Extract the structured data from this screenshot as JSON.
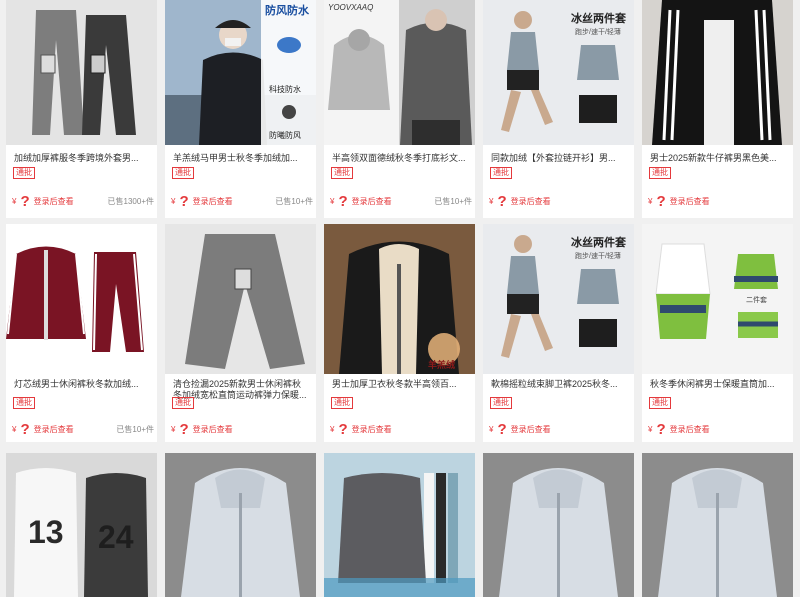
{
  "products": [
    {
      "title": "加绒加厚裤服冬季跨境外套男...",
      "badge": "通批",
      "yen": "¥",
      "price_mark": "?",
      "login_text": "登录后查看",
      "sold": "已售1300+件",
      "image_icon": "grey-sweatpants-image"
    },
    {
      "title": "羊羔绒马甲男士秋冬季加绒加...",
      "badge": "通批",
      "yen": "¥",
      "price_mark": "?",
      "login_text": "登录后查看",
      "sold": "已售10+件",
      "image_icon": "black-jacket-model-image",
      "image_text": [
        "防风防水",
        "科技防水",
        "防曦防风"
      ]
    },
    {
      "title": "半高领双面德绒秋冬季打底衫文...",
      "badge": "通批",
      "yen": "¥",
      "price_mark": "?",
      "login_text": "登录后查看",
      "sold": "已售10+件",
      "image_icon": "grey-hoodie-image",
      "image_text": [
        "YOOVXAAQ"
      ]
    },
    {
      "title": "同款加绒【外套拉链开衫】男...",
      "badge": "通批",
      "yen": "¥",
      "price_mark": "?",
      "login_text": "登录后查看",
      "sold": "",
      "image_icon": "running-set-image",
      "image_text": [
        "冰丝两件套",
        "跑步/速干/轻薄"
      ]
    },
    {
      "title": "男士2025新款牛仔裤男黑色美...",
      "badge": "通批",
      "yen": "¥",
      "price_mark": "?",
      "login_text": "登录后查看",
      "sold": "",
      "image_icon": "black-track-jacket-image"
    },
    {
      "title": "灯芯绒男士休闲裤秋冬款加绒...",
      "badge": "通批",
      "yen": "¥",
      "price_mark": "?",
      "login_text": "登录后查看",
      "sold": "已售10+件",
      "image_icon": "maroon-tracksuit-image"
    },
    {
      "title": "清仓捡漏2025新款男士休闲裤秋冬加绒宽松直筒运动裤弹力保暖...",
      "badge": "通批",
      "yen": "¥",
      "price_mark": "?",
      "login_text": "登录后查看",
      "sold": "",
      "image_icon": "grey-sweatpants-image"
    },
    {
      "title": "男士加厚卫衣秋冬款半高领百...",
      "badge": "通批",
      "yen": "¥",
      "price_mark": "?",
      "login_text": "登录后查看",
      "sold": "",
      "image_icon": "sherpa-hoodie-image",
      "image_text": [
        "羊羔绒"
      ]
    },
    {
      "title": "軟棉摇粒绒束脚卫裤2025秋冬...",
      "badge": "通批",
      "yen": "¥",
      "price_mark": "?",
      "login_text": "登录后查看",
      "sold": "",
      "image_icon": "running-set-image",
      "image_text": [
        "冰丝两件套",
        "跑步/速干/轻薄"
      ]
    },
    {
      "title": "秋冬季休闲裤男士保暖直筒加...",
      "badge": "通批",
      "yen": "¥",
      "price_mark": "?",
      "login_text": "登录后查看",
      "sold": "",
      "image_icon": "tie-dye-set-image",
      "image_text": [
        "二件套"
      ]
    },
    {
      "image_icon": "tank-top-image",
      "image_text": [
        "13",
        "24"
      ]
    },
    {
      "image_icon": "sun-jacket-image"
    },
    {
      "image_icon": "grey-vest-image"
    },
    {
      "image_icon": "sun-jacket-image"
    },
    {
      "image_icon": "sun-jacket-image"
    }
  ]
}
